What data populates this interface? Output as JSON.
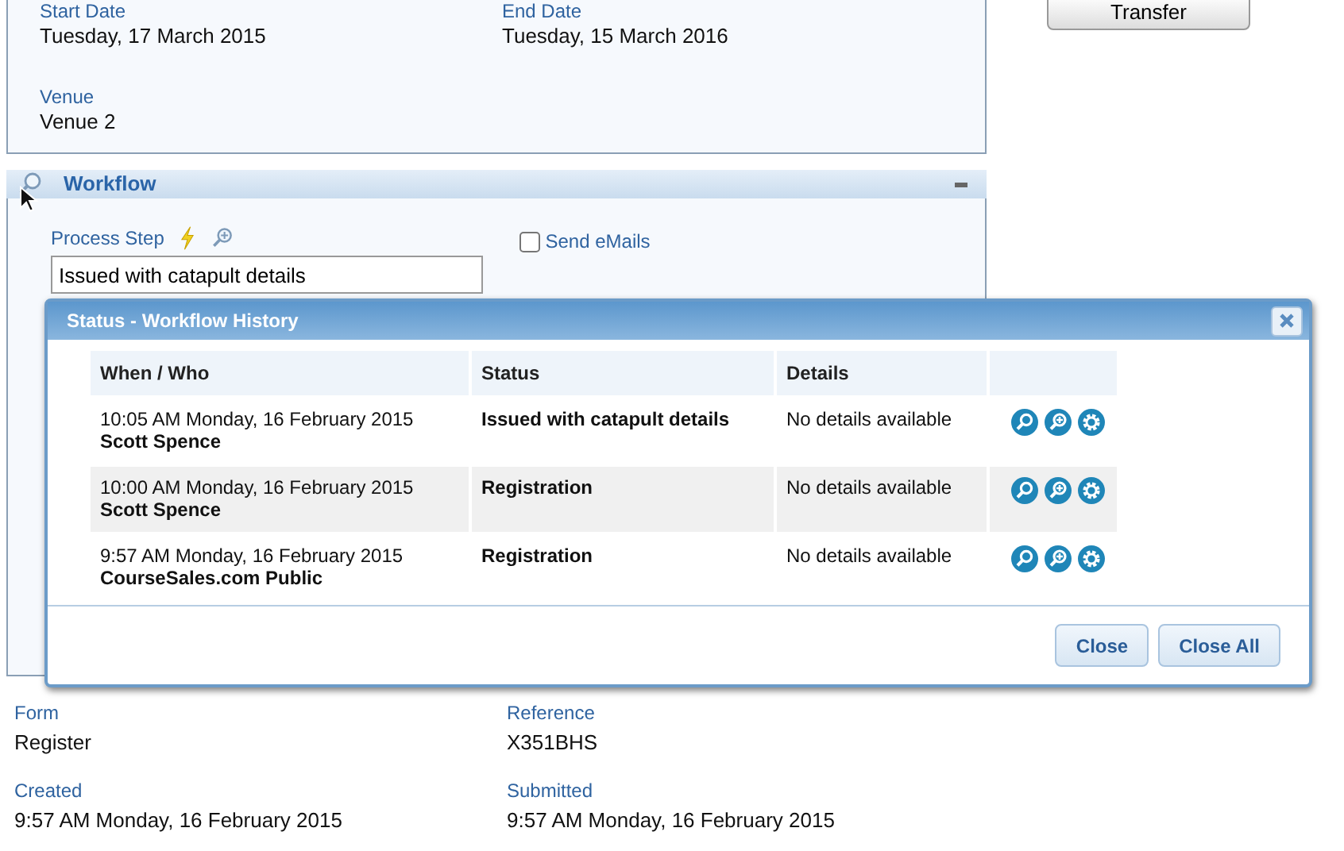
{
  "toolbar": {
    "transfer_button": "Transfer"
  },
  "event": {
    "fields": [
      {
        "label": "Start Date",
        "value": "Tuesday, 17 March 2015"
      },
      {
        "label": "End Date",
        "value": "Tuesday, 15 March 2016"
      },
      {
        "label": "Venue",
        "value": "Venue 2"
      }
    ]
  },
  "workflow": {
    "title": "Workflow",
    "process_step": {
      "label": "Process Step",
      "value": "Issued with catapult details"
    },
    "send_emails": {
      "label": "Send eMails",
      "checked": false
    }
  },
  "record": {
    "fields": [
      {
        "label": "Form",
        "value": "Register"
      },
      {
        "label": "Reference",
        "value": "X351BHS"
      },
      {
        "label": "Created",
        "value": "9:57 AM Monday, 16 February 2015"
      },
      {
        "label": "Submitted",
        "value": "9:57 AM Monday, 16 February 2015"
      }
    ]
  },
  "dialog": {
    "title": "Status - Workflow History",
    "columns": [
      "When / Who",
      "Status",
      "Details"
    ],
    "rows": [
      {
        "when": "10:05 AM Monday, 16 February 2015",
        "who": "Scott Spence",
        "status": "Issued with catapult details",
        "details": "No details available"
      },
      {
        "when": "10:00 AM Monday, 16 February 2015",
        "who": "Scott Spence",
        "status": "Registration",
        "details": "No details available"
      },
      {
        "when": "9:57 AM Monday, 16 February 2015",
        "who": "CourseSales.com Public",
        "status": "Registration",
        "details": "No details available"
      }
    ],
    "buttons": [
      "Close",
      "Close All"
    ]
  }
}
